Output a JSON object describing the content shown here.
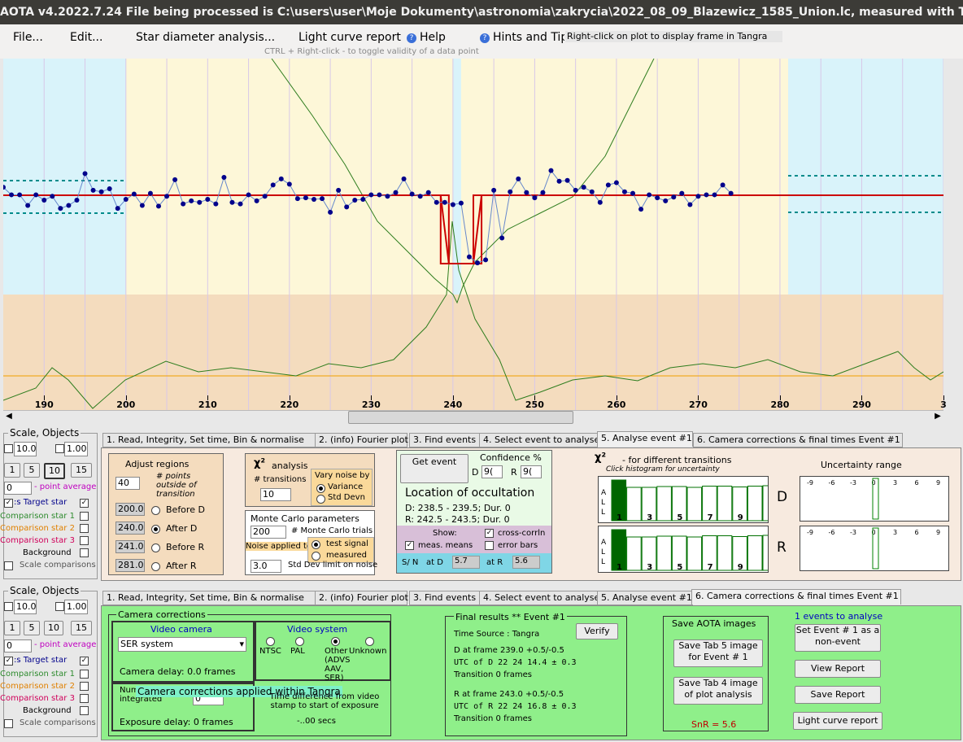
{
  "window": {
    "title": "AOTA v4.2022.7.24    File being processed is C:\\users\\user\\Moje Dokumenty\\astronomia\\zakrycia\\2022_08_09_Blazewicz_1585_Union.lc, measured with Tangra"
  },
  "menu": {
    "file": "File...",
    "edit": "Edit...",
    "star_diameter": "Star diameter analysis...",
    "light_curve": "Light curve report",
    "help": "Help",
    "hints": "Hints and Tips",
    "tip": "Right-click on plot to display frame in Tangra",
    "ctrl_note": "CTRL + Right-click   -   to toggle validity of a data point"
  },
  "plot": {
    "x_ticks": [
      "190",
      "200",
      "210",
      "220",
      "230",
      "240",
      "250",
      "260",
      "270",
      "280",
      "290",
      "3"
    ]
  },
  "left_panel": {
    "title": "Scale, Objects",
    "scale1": "10.0",
    "scale2": "1.00",
    "bin_buttons": [
      "1",
      "5",
      "10",
      "15"
    ],
    "average_value": "0",
    "average_label": "- point average",
    "target_label": ":s  Target star",
    "comp1": "Comparison star 1",
    "comp2": "Comparison star 2",
    "comp3": "Comparison star 3",
    "background": "Background",
    "scale_comparisons": "Scale comparisons"
  },
  "tabs": [
    "1.  Read, Integrity, Set time, Bin & normalise",
    "2. (info)  Fourier plot",
    "3. Find events",
    "4. Select event to analyse",
    "5. Analyse event #1",
    "6. Camera corrections & final times Event #1"
  ],
  "tab5": {
    "adjust_title": "Adjust regions",
    "points_value": "40",
    "points_label": "# points outside of transition",
    "regions": [
      {
        "value": "200.0",
        "label": "Before D"
      },
      {
        "value": "240.0",
        "label": "After D"
      },
      {
        "value": "241.0",
        "label": "Before R"
      },
      {
        "value": "281.0",
        "label": "After R"
      }
    ],
    "chi_title": "analysis",
    "transitions_label": "# transitions",
    "transitions_value": "10",
    "vary_noise": "Vary noise by",
    "variance": "Variance",
    "std_devn": "Std Devn",
    "mc_title": "Monte Carlo parameters",
    "mc_trials_value": "200",
    "mc_trials_label": "# Monte Carlo trials",
    "noise_applied": "Noise applied to",
    "test_signal": "test signal",
    "measured": "measured",
    "std_limit_value": "3.0",
    "std_limit_label": "Std Dev limit on noise",
    "get_event": "Get event",
    "confidence": "Confidence %",
    "d_label": "D",
    "d_conf": "9(",
    "r_label": "R",
    "r_conf": "9(",
    "location_title": "Location of occultation",
    "d_location": "D: 238.5 - 239.5; Dur. 0",
    "r_location": "R: 242.5 - 243.5; Dur. 0",
    "show": "Show:",
    "cross_corr": "cross-corrln",
    "meas_means": "meas. means",
    "error_bars": "error bars",
    "sn": "S/ N",
    "at_d": "at D",
    "sn_d": "5.7",
    "at_r": "at R",
    "sn_r": "5.6",
    "chi_hist_title": "- for different transitions",
    "chi_hist_sub": "Click histogram for uncertainty",
    "hist_labels": [
      "1",
      "3",
      "5",
      "7",
      "9",
      "11"
    ],
    "uncertainty_title": "Uncertainty range",
    "unc_ticks": [
      "-9",
      "-6",
      "-3",
      "0",
      "3",
      "6",
      "9"
    ],
    "D": "D",
    "R": "R",
    "all": [
      "A",
      "L",
      "L"
    ]
  },
  "tab6": {
    "camera_corrections": "Camera corrections",
    "video_camera": "Video camera",
    "camera_select": "SER system",
    "camera_delay": "Camera delay: 0.0 frames",
    "video_system": "Video system",
    "ntsc": "NTSC",
    "pal": "PAL",
    "other": "Other (ADVS AAV, SER)",
    "unknown": "Unknown",
    "num_frames": "Num frames integrated",
    "frames_value": "0",
    "overlay": "Camera corrections applied within Tangra",
    "exposure_delay": "Exposure delay:  0 frames",
    "time_diff": "Time difference from video stamp to start of exposure",
    "time_diff_value": "-..00 secs",
    "final_results": "Final results  **  Event #1",
    "time_source": "Time Source :    Tangra",
    "verify": "Verify",
    "d_frame": "D    at frame 239.0  +0.5/-0.5",
    "utc_d": "UTC of D    22 24 14.4    ± 0.3",
    "transition_d": "Transition  0 frames",
    "r_frame": "R    at frame 243.0  +0.5/-0.5",
    "utc_r": "UTC of R    22 24 16.8    ± 0.3",
    "transition_r": "Transition  0 frames",
    "save_images": "Save AOTA images",
    "save_tab5": "Save Tab 5 image for Event # 1",
    "save_tab4": "Save Tab 4 image of plot analysis",
    "snr": "SnR = 5.6",
    "events_to_analyse": "1 events to analyse",
    "set_event": "Set Event # 1 as a non-event",
    "view_report": "View Report",
    "save_report": "Save Report",
    "lc_report": "Light curve report"
  },
  "colors": {
    "plot_blue": "#d9f3fa",
    "plot_yellow": "#fdf7d8",
    "plot_tan": "#f4dcbe",
    "green_panel": "#8fef8a",
    "red": "#cc0000",
    "green_line": "#2e7d1e",
    "point": "#00008b"
  },
  "chart_data": {
    "type": "scatter",
    "x_range": [
      185,
      300
    ],
    "points_x": [
      184,
      185,
      186,
      187,
      188,
      189,
      190,
      191,
      192,
      193,
      194,
      195,
      196,
      197,
      198,
      199,
      200,
      201,
      202,
      203,
      204,
      205,
      206,
      207,
      208,
      209,
      210,
      211,
      212,
      213,
      214,
      215,
      216,
      217,
      218,
      219,
      220,
      221,
      222,
      223,
      224,
      225,
      226,
      227,
      228,
      229,
      230,
      231,
      232,
      233,
      234,
      235,
      236,
      237,
      238,
      239,
      240,
      241,
      242,
      243,
      244,
      245,
      246,
      247,
      248,
      249,
      250,
      251,
      252,
      253,
      254,
      255,
      256,
      257,
      258,
      259,
      260,
      261,
      262,
      263,
      264,
      265,
      266,
      267,
      268,
      269,
      270,
      271,
      272,
      273,
      274,
      275,
      276,
      277,
      278,
      279,
      280,
      281,
      282,
      283,
      284,
      285,
      286,
      287,
      288,
      289,
      290,
      291,
      292,
      293,
      294,
      295,
      296,
      297,
      298,
      299,
      300
    ],
    "points_y": [
      0.95,
      1.02,
      0.92,
      0.92,
      0.78,
      0.92,
      0.85,
      0.9,
      0.74,
      0.78,
      0.85,
      1.2,
      0.98,
      0.96,
      1.0,
      0.74,
      0.86,
      0.93,
      0.78,
      0.94,
      0.77,
      0.9,
      1.12,
      0.8,
      0.84,
      0.82,
      0.86,
      0.8,
      1.15,
      0.82,
      0.8,
      0.92,
      0.84,
      0.9,
      1.05,
      1.13,
      1.06,
      0.87,
      0.88,
      0.86,
      0.87,
      0.69,
      0.98,
      0.76,
      0.85,
      0.86,
      0.92,
      0.92,
      0.9,
      0.95,
      1.13,
      0.93,
      0.9,
      0.95,
      0.82,
      0.82,
      0.79,
      0.81,
      0.1,
      0.02,
      0.06,
      0.98,
      0.35,
      0.96,
      1.13,
      0.95,
      0.88,
      0.95,
      1.24,
      1.1,
      1.11,
      0.98,
      1.02,
      0.96,
      0.82,
      1.05,
      1.08,
      0.96,
      0.94,
      0.73,
      0.92,
      0.88,
      0.84,
      0.89,
      0.94,
      0.79,
      0.9,
      0.92,
      0.92,
      1.05,
      0.94
    ],
    "event_d": 239,
    "event_r": 243
  }
}
